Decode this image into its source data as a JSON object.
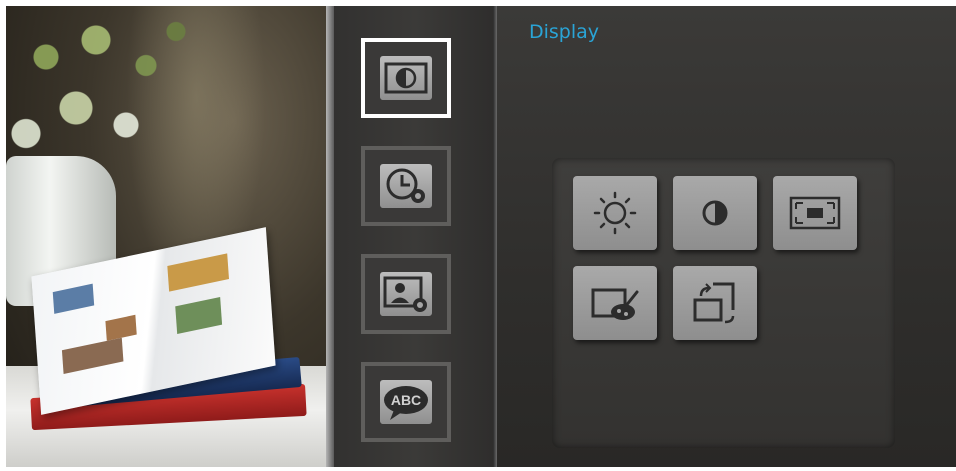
{
  "page": {
    "title": "Display"
  },
  "sidebar": {
    "categories": [
      {
        "icon": "display-contrast-icon",
        "active": true
      },
      {
        "icon": "clock-settings-icon",
        "active": false
      },
      {
        "icon": "photo-settings-icon",
        "active": false
      },
      {
        "icon": "language-abc-icon",
        "label": "ABC",
        "active": false
      }
    ]
  },
  "display_options": [
    {
      "icon": "brightness-icon"
    },
    {
      "icon": "contrast-icon"
    },
    {
      "icon": "aspect-ratio-icon"
    },
    {
      "icon": "color-palette-icon"
    },
    {
      "icon": "rotate-screen-icon"
    }
  ],
  "colors": {
    "accent": "#2aa4d6",
    "active_border": "#ffffff",
    "button_gray": "#9e9e9e"
  }
}
